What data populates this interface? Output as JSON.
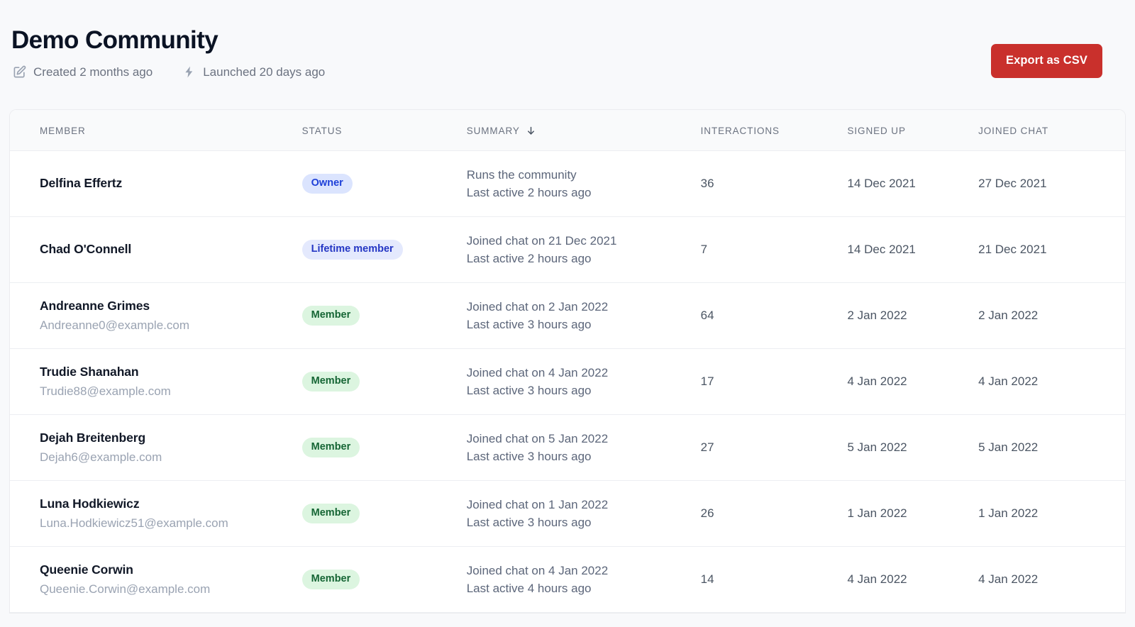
{
  "header": {
    "title": "Demo Community",
    "meta": [
      {
        "icon": "edit-square-icon",
        "text": "Created 2 months ago"
      },
      {
        "icon": "lightning-bolt-icon",
        "text": "Launched 20 days ago"
      }
    ],
    "export_button": "Export as CSV",
    "export_button_color": "#c9302c"
  },
  "table": {
    "columns": [
      {
        "key": "member",
        "label": "MEMBER",
        "sorted": false
      },
      {
        "key": "status",
        "label": "STATUS",
        "sorted": false
      },
      {
        "key": "summary",
        "label": "SUMMARY",
        "sorted": true,
        "sort_direction": "desc",
        "sort_glyph": "↓"
      },
      {
        "key": "interactions",
        "label": "INTERACTIONS",
        "sorted": false
      },
      {
        "key": "signed_up",
        "label": "SIGNED UP",
        "sorted": false
      },
      {
        "key": "joined_chat",
        "label": "JOINED CHAT",
        "sorted": false
      }
    ],
    "badge_colors": {
      "Owner": {
        "bg": "#dbe4fe",
        "fg": "#1d3fd8"
      },
      "Lifetime member": {
        "bg": "#e4e9fd",
        "fg": "#2436c4"
      },
      "Member": {
        "bg": "#dcf5e0",
        "fg": "#156534"
      }
    },
    "rows": [
      {
        "name": "Delfina Effertz",
        "email": "",
        "status": "Owner",
        "status_class": "badge-owner",
        "summary_line1": "Runs the community",
        "summary_line2": "Last active 2 hours ago",
        "interactions": "36",
        "signed_up": "14 Dec 2021",
        "joined_chat": "27 Dec 2021"
      },
      {
        "name": "Chad O'Connell",
        "email": "",
        "status": "Lifetime member",
        "status_class": "badge-lifetime",
        "summary_line1": "Joined chat on 21 Dec 2021",
        "summary_line2": "Last active 2 hours ago",
        "interactions": "7",
        "signed_up": "14 Dec 2021",
        "joined_chat": "21 Dec 2021"
      },
      {
        "name": "Andreanne Grimes",
        "email": "Andreanne0@example.com",
        "status": "Member",
        "status_class": "badge-member",
        "summary_line1": "Joined chat on 2 Jan 2022",
        "summary_line2": "Last active 3 hours ago",
        "interactions": "64",
        "signed_up": "2 Jan 2022",
        "joined_chat": "2 Jan 2022"
      },
      {
        "name": "Trudie Shanahan",
        "email": "Trudie88@example.com",
        "status": "Member",
        "status_class": "badge-member",
        "summary_line1": "Joined chat on 4 Jan 2022",
        "summary_line2": "Last active 3 hours ago",
        "interactions": "17",
        "signed_up": "4 Jan 2022",
        "joined_chat": "4 Jan 2022"
      },
      {
        "name": "Dejah Breitenberg",
        "email": "Dejah6@example.com",
        "status": "Member",
        "status_class": "badge-member",
        "summary_line1": "Joined chat on 5 Jan 2022",
        "summary_line2": "Last active 3 hours ago",
        "interactions": "27",
        "signed_up": "5 Jan 2022",
        "joined_chat": "5 Jan 2022"
      },
      {
        "name": "Luna Hodkiewicz",
        "email": "Luna.Hodkiewicz51@example.com",
        "status": "Member",
        "status_class": "badge-member",
        "summary_line1": "Joined chat on 1 Jan 2022",
        "summary_line2": "Last active 3 hours ago",
        "interactions": "26",
        "signed_up": "1 Jan 2022",
        "joined_chat": "1 Jan 2022"
      },
      {
        "name": "Queenie Corwin",
        "email": "Queenie.Corwin@example.com",
        "status": "Member",
        "status_class": "badge-member",
        "summary_line1": "Joined chat on 4 Jan 2022",
        "summary_line2": "Last active 4 hours ago",
        "interactions": "14",
        "signed_up": "4 Jan 2022",
        "joined_chat": "4 Jan 2022"
      }
    ]
  }
}
